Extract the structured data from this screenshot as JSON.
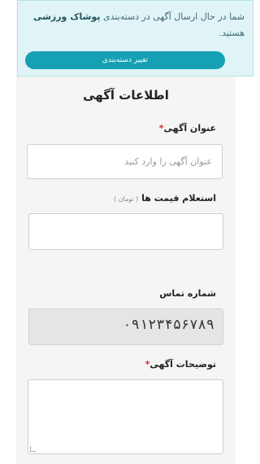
{
  "notice": {
    "text_before": "شما در حال ارسال آگهی در دسته‌بندی",
    "category": "پوشاک ورزشی",
    "text_after": "هستید.",
    "change_button": "تغییر دسته‌بندی"
  },
  "section_title": "اطلاعات آگهی",
  "fields": {
    "title": {
      "label": "عنوان آگهی",
      "required_mark": "*",
      "placeholder": "عنوان آگهی را وارد کنید",
      "value": ""
    },
    "price": {
      "label": "استعلام قیمت ها",
      "unit": "( تومان )",
      "value": ""
    },
    "phone": {
      "label": "شماره تماس",
      "value": "۰۹۱۲۳۴۵۶۷۸۹"
    },
    "description": {
      "label": "توضیحات آگهی",
      "required_mark": "*",
      "value": ""
    }
  },
  "colors": {
    "accent": "#15a0b3",
    "notice_bg": "#e0f4f7",
    "required": "#d9232e"
  }
}
